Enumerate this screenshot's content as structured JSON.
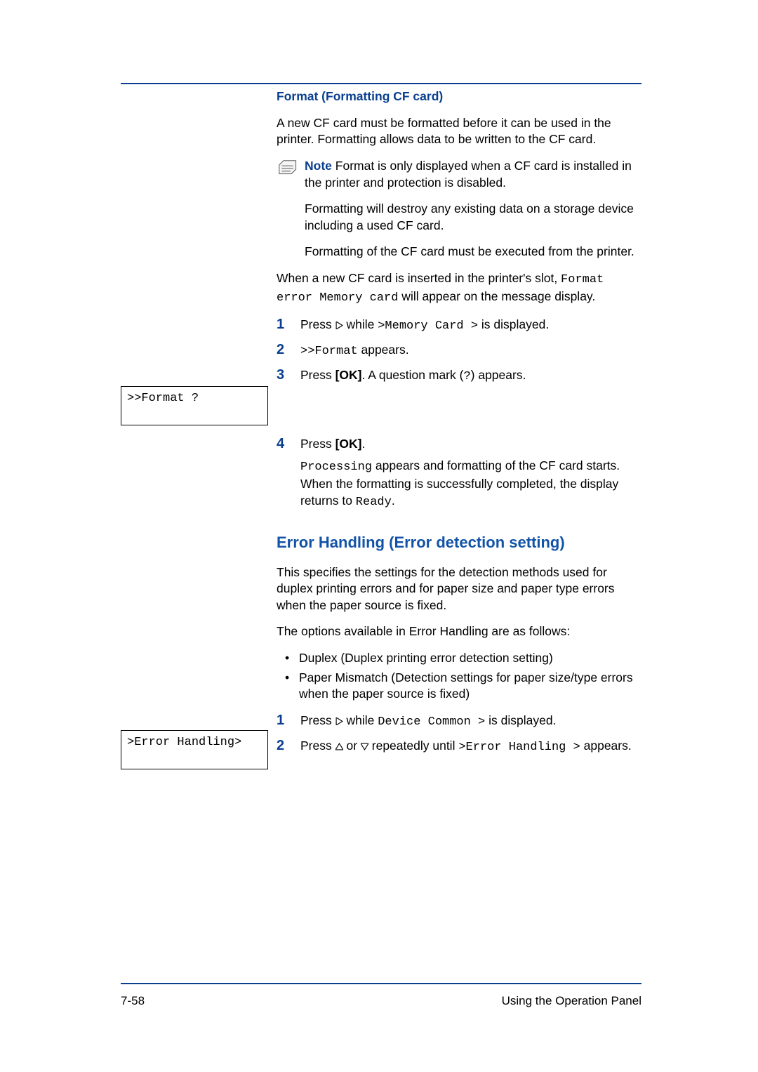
{
  "header": {},
  "footer": {
    "page": "7-58",
    "section": "Using the Operation Panel"
  },
  "lcd": {
    "format": ">>Format ?",
    "error": ">Error Handling>"
  },
  "s1": {
    "title": "Format (Formatting CF card)",
    "intro": "A new CF card must be formatted before it can be used in the printer. Formatting allows data to be written to the CF card.",
    "note_label": "Note",
    "note_text": "Format is only displayed when a CF card is installed in the printer and protection is disabled.",
    "note_sub1": "Formatting will destroy any existing data on a storage device including a used CF card.",
    "note_sub2": "Formatting of the CF card must be executed from the printer.",
    "p2a": "When a new CF card is inserted in the printer's slot, ",
    "p2b": "Format error Memory card",
    "p2c": " will appear on the message display.",
    "step1_a": "Press ",
    "step1_b": " while ",
    "step1_c": ">Memory Card >",
    "step1_d": " is displayed.",
    "step2_a": ">>Format",
    "step2_b": " appears.",
    "step3_a": "Press ",
    "step3_ok": "[OK]",
    "step3_b": ". A question mark (",
    "step3_q": "?",
    "step3_c": ") appears.",
    "step4_a": "Press ",
    "step4_ok": "[OK]",
    "step4_b": ".",
    "step4_sub_a": "Processing",
    "step4_sub_b": " appears and formatting of the CF card starts. When the formatting is successfully completed, the display returns to ",
    "step4_sub_c": "Ready",
    "step4_sub_d": "."
  },
  "s2": {
    "title": "Error Handling (Error detection setting)",
    "intro": "This specifies the settings for the detection methods used for duplex printing errors and for paper size and paper type errors when the paper source is fixed.",
    "opts": "The options available in Error Handling are as follows:",
    "b1": "Duplex (Duplex printing error detection setting)",
    "b2": "Paper Mismatch (Detection settings for paper size/type errors when the paper source is fixed)",
    "step1_a": "Press ",
    "step1_b": " while ",
    "step1_c": "Device Common >",
    "step1_d": " is displayed.",
    "step2_a": "Press ",
    "step2_b": " or ",
    "step2_c": " repeatedly until ",
    "step2_d": ">Error Handling >",
    "step2_e": " appears."
  },
  "numbers": {
    "n1": "1",
    "n2": "2",
    "n3": "3",
    "n4": "4"
  }
}
